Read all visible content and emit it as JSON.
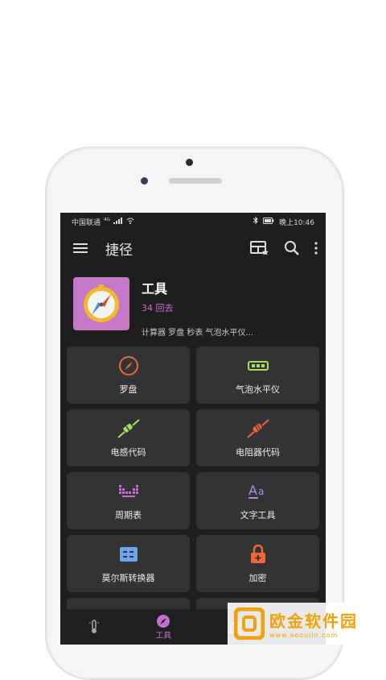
{
  "status": {
    "carrier": "中国联通",
    "net": "⁴ᴳ",
    "time": "晚上10:46"
  },
  "appbar": {
    "title": "捷径"
  },
  "header": {
    "name": "工具",
    "count": "34 回去",
    "desc": "计算器 罗盘 秒表 气泡水平仪..."
  },
  "cards": [
    {
      "label": "罗盘",
      "icon": "compass-icon"
    },
    {
      "label": "气泡水平仪",
      "icon": "bubble-level-icon"
    },
    {
      "label": "电感代码",
      "icon": "inductor-icon"
    },
    {
      "label": "电阻器代码",
      "icon": "resistor-icon"
    },
    {
      "label": "周期表",
      "icon": "periodic-table-icon"
    },
    {
      "label": "文字工具",
      "icon": "text-tools-icon"
    },
    {
      "label": "莫尔斯转换器",
      "icon": "morse-icon"
    },
    {
      "label": "加密",
      "icon": "lock-icon"
    }
  ],
  "bottomnav": {
    "active_label": "工具"
  },
  "watermark": {
    "title": "欧金软件园",
    "url": "www.aooujin.com"
  },
  "colors": {
    "accent": "#c86fd0",
    "compass": "#f0663a",
    "level": "#a6e05a",
    "inductor": "#a6e05a",
    "resistor": "#f0663a",
    "periodic": "#c86fd0",
    "text": "#b08ae8",
    "morse": "#6fa2f0",
    "lock": "#f0663a"
  }
}
